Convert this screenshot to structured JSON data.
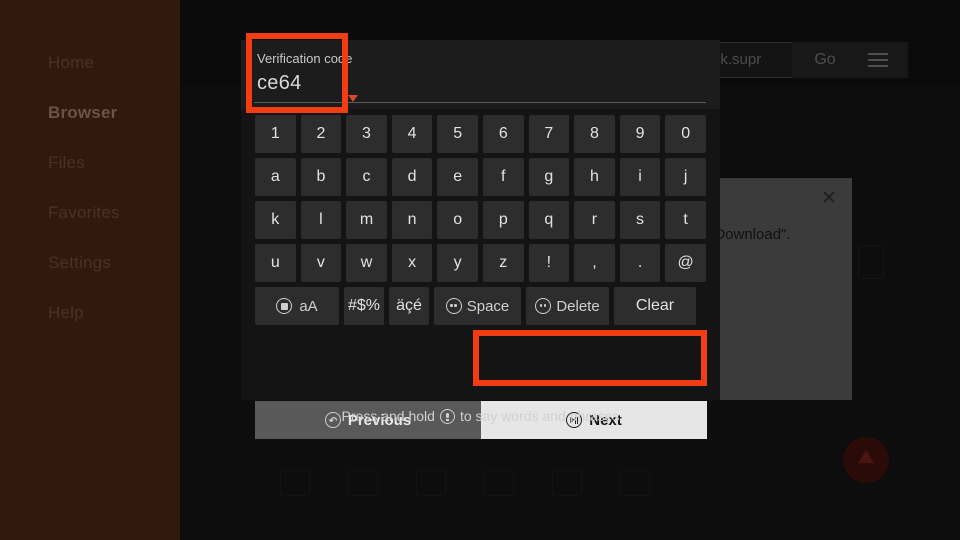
{
  "sidebar": {
    "items": [
      {
        "label": "Home",
        "active": false
      },
      {
        "label": "Browser",
        "active": true
      },
      {
        "label": "Files",
        "active": false
      },
      {
        "label": "Favorites",
        "active": false
      },
      {
        "label": "Settings",
        "active": false
      },
      {
        "label": "Help",
        "active": false
      }
    ]
  },
  "browser_bar": {
    "url_value": "ork.supr",
    "go_label": "Go",
    "menu_icon": "hamburger-menu-icon"
  },
  "dialog": {
    "close_icon": "close-icon",
    "text": "\"Download\"."
  },
  "keyboard": {
    "field": {
      "label": "Verification code",
      "value": "ce64"
    },
    "rows": [
      [
        "1",
        "2",
        "3",
        "4",
        "5",
        "6",
        "7",
        "8",
        "9",
        "0"
      ],
      [
        "a",
        "b",
        "c",
        "d",
        "e",
        "f",
        "g",
        "h",
        "i",
        "j"
      ],
      [
        "k",
        "l",
        "m",
        "n",
        "o",
        "p",
        "q",
        "r",
        "s",
        "t"
      ],
      [
        "u",
        "v",
        "w",
        "x",
        "y",
        "z",
        "!",
        ",",
        ".",
        "@"
      ]
    ],
    "function_row": {
      "case_label": "aA",
      "case_icon": "select-square-icon",
      "symbols_label": "#$%",
      "accents_label": "äçé",
      "space_label": "Space",
      "space_icon": "fast-forward-circle-icon",
      "delete_label": "Delete",
      "delete_icon": "rewind-circle-icon",
      "clear_label": "Clear"
    },
    "actions": {
      "previous_label": "Previous",
      "previous_icon": "rewind-circle-icon",
      "next_label": "Next",
      "next_icon": "play-pause-circle-icon"
    }
  },
  "voice_hint": {
    "text_before": "Press and hold",
    "mic_icon": "microphone-circle-icon",
    "text_after": "to say words and phrases"
  },
  "annotations": {
    "color": "#f23c14",
    "boxes": [
      "verification-code-field",
      "next-button"
    ]
  }
}
